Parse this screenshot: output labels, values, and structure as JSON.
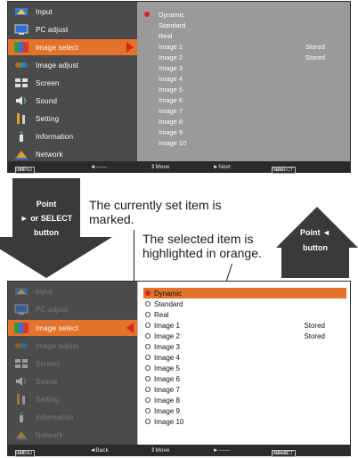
{
  "menu": {
    "items": [
      {
        "label": "Input",
        "icon": "input-icon"
      },
      {
        "label": "PC adjust",
        "icon": "pc-adjust-icon"
      },
      {
        "label": "Image select",
        "icon": "image-select-icon"
      },
      {
        "label": "Image adjust",
        "icon": "image-adjust-icon"
      },
      {
        "label": "Screen",
        "icon": "screen-icon"
      },
      {
        "label": "Sound",
        "icon": "sound-icon"
      },
      {
        "label": "Setting",
        "icon": "setting-icon"
      },
      {
        "label": "Information",
        "icon": "information-icon"
      },
      {
        "label": "Network",
        "icon": "network-icon"
      }
    ],
    "selected": "Image select"
  },
  "options": [
    {
      "label": "Dynamic",
      "stored": ""
    },
    {
      "label": "Standard",
      "stored": ""
    },
    {
      "label": "Real",
      "stored": ""
    },
    {
      "label": "Image 1",
      "stored": "Stored"
    },
    {
      "label": "Image 2",
      "stored": "Stored"
    },
    {
      "label": "Image 3",
      "stored": ""
    },
    {
      "label": "Image 4",
      "stored": ""
    },
    {
      "label": "Image 5",
      "stored": ""
    },
    {
      "label": "Image 6",
      "stored": ""
    },
    {
      "label": "Image 7",
      "stored": ""
    },
    {
      "label": "Image 8",
      "stored": ""
    },
    {
      "label": "Image 9",
      "stored": ""
    },
    {
      "label": "Image 10",
      "stored": ""
    }
  ],
  "bar_top": {
    "exit_key": "MENU",
    "exit": "Exit",
    "back_key": "◄------",
    "move": "⇕Move",
    "next_key": "►Next",
    "select_key": "SELECT",
    "next": "Next"
  },
  "bar_bottom": {
    "exit_key": "MENU",
    "exit": "Exit",
    "back": "◄Back",
    "move": "⇕Move",
    "dash": "►------",
    "select_key": "SELECT",
    "select": "Select"
  },
  "unselected_marker": "O",
  "callouts": {
    "point_select": {
      "line1": "Point",
      "line2": "► or SELECT",
      "line3": "button"
    },
    "point_left": {
      "line1": "Point ◄",
      "line2": "button"
    },
    "current_note": {
      "line1": "The currently set item is",
      "line2": "marked."
    },
    "selected_note": {
      "line1": "The selected item is",
      "line2": "highlighted in orange."
    }
  },
  "colors": {
    "highlight": "#e3732a",
    "marker": "#d9241c",
    "menu_bg": "#4b4b4b",
    "list_bg": "#9a9a9a"
  }
}
